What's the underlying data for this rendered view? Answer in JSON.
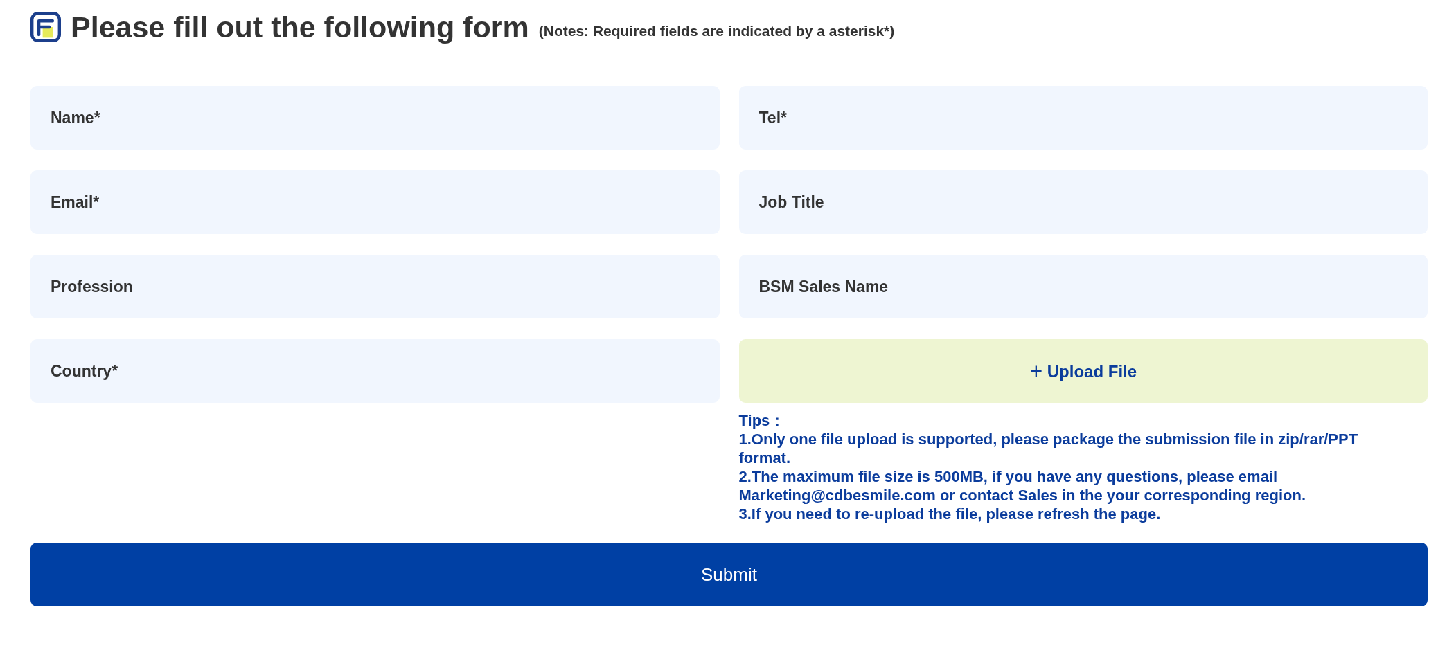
{
  "title": "Please fill out the following form",
  "note": "(Notes: Required fields are indicated by a asterisk*)",
  "fields": [
    {
      "placeholder": "Name*"
    },
    {
      "placeholder": "Tel*"
    },
    {
      "placeholder": "Email*"
    },
    {
      "placeholder": "Job Title"
    },
    {
      "placeholder": "Profession"
    },
    {
      "placeholder": "BSM Sales Name"
    },
    {
      "placeholder": "Country*"
    }
  ],
  "upload": {
    "icon": "+",
    "label": "Upload File"
  },
  "tips": [
    "Tips：",
    "1.Only one file upload is supported, please package the submission file in zip/rar/PPT format.",
    "2.The maximum file size is 500MB, if you have any questions, please email Marketing@cdbesmile.com or contact Sales in the your corresponding region.",
    "3.If you need to re-upload the file, please refresh the page."
  ],
  "submit": "Submit"
}
